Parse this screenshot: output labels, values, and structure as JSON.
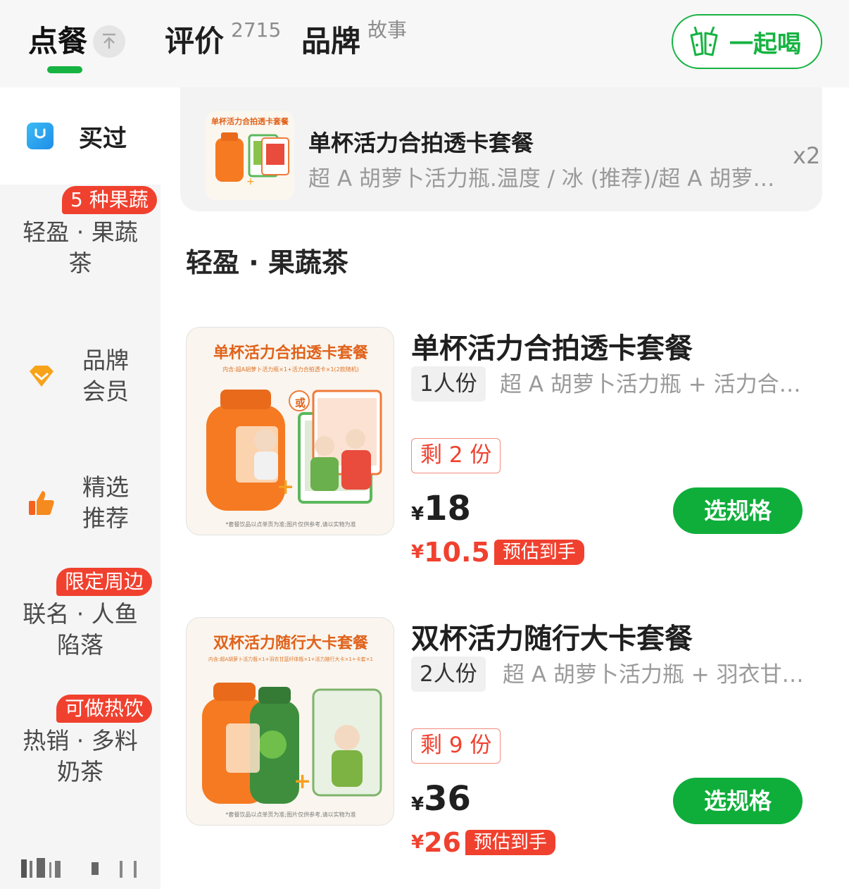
{
  "tabs": {
    "order": "点餐",
    "pin": "不",
    "review": "评价",
    "review_count": "2715",
    "brand": "品牌",
    "brand_sup": "故事"
  },
  "drink_together": "一起喝",
  "sidebar": {
    "active": "买过",
    "items": [
      {
        "badge": "5 种果蔬",
        "line1": "轻盈 · 果蔬",
        "line2": "茶"
      },
      {
        "line1": "品牌",
        "line2": "会员",
        "icon": "crown-icon"
      },
      {
        "line1": "精选",
        "line2": "推荐",
        "icon": "thumbs-up-icon"
      },
      {
        "badge": "限定周边",
        "line1": "联名 · 人鱼",
        "line2": "陷落"
      },
      {
        "badge": "可做热饮",
        "line1": "热销 · 多料",
        "line2": "奶茶"
      }
    ]
  },
  "bought": {
    "title": "单杯活力合拍透卡套餐",
    "desc": "超 A 胡萝卜活力瓶.温度 / 冰 (推荐)/超 A 胡萝卜活力瓶",
    "qty": "x2",
    "thumb_title": "单杯活力合拍透卡套餐"
  },
  "section_title": "轻盈 · 果蔬茶",
  "products": [
    {
      "name": "单杯活力合拍透卡套餐",
      "serve": "1人份",
      "desc": "超 A 胡萝卜活力瓶 + 活力合拍透卡",
      "left": "剩 2 份",
      "price_symbol": "¥",
      "price": "18",
      "est_price": "10.5",
      "est_tag": "预估到手",
      "spec_button": "选规格",
      "img_title": "单杯活力合拍透卡套餐",
      "img_sub": "内含:超A胡萝卜活力瓶×1+活力合拍透卡×1(2款随机)",
      "img_note": "*套餐饮品以点单页为准;图片仅供参考,请以实物为准",
      "img_or": "或"
    },
    {
      "name": "双杯活力随行大卡套餐",
      "serve": "2人份",
      "desc": "超 A 胡萝卜活力瓶 + 羽衣甘蓝纤体瓶",
      "left": "剩 9 份",
      "price_symbol": "¥",
      "price": "36",
      "est_price": "26",
      "est_tag": "预估到手",
      "spec_button": "选规格",
      "img_title": "双杯活力随行大卡套餐",
      "img_sub": "内含:超A胡萝卜活力瓶×1+羽衣甘蓝纤体瓶×1+活力随行大卡×1+卡套×1",
      "img_note": "*套餐饮品以点单页为准;图片仅供参考,请以实物为准"
    }
  ],
  "colors": {
    "brand_green": "#16b342",
    "price_red": "#f0412f",
    "carrot_orange": "#f57a22"
  }
}
